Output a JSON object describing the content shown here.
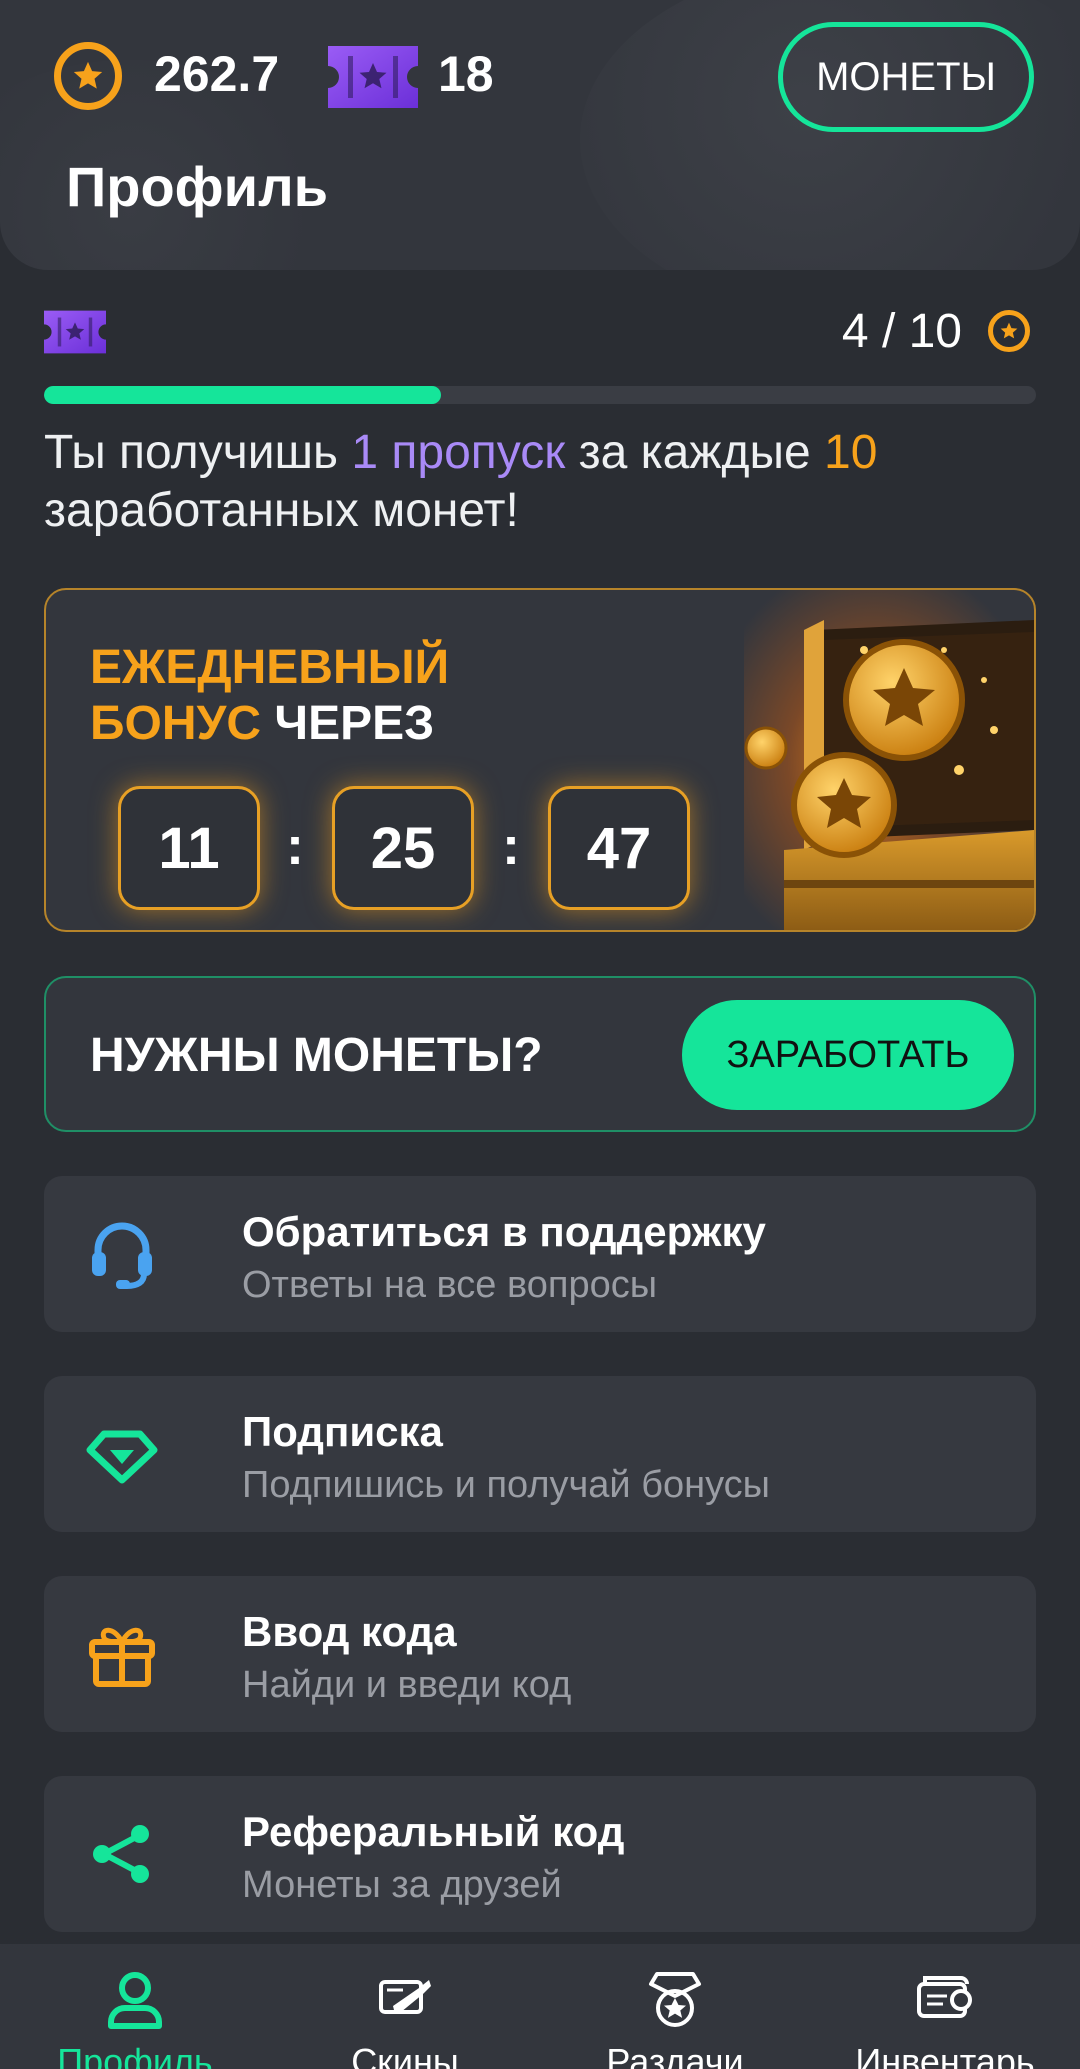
{
  "header": {
    "coins_balance": "262.7",
    "tickets_count": "18",
    "coins_button": "МОНЕТЫ",
    "page_title": "Профиль"
  },
  "progress": {
    "count": "4 / 10",
    "fraction": 0.4,
    "text_part1": "Ты получишь ",
    "text_highlight1": "1 пропуск",
    "text_part2": " за каждые ",
    "text_highlight2": "10",
    "text_part3": " заработанных монет!"
  },
  "daily_bonus": {
    "title_line1": "ЕЖЕДНЕВНЫЙ",
    "title_line2_highlight": "БОНУС",
    "title_line2_rest": " ЧЕРЕЗ",
    "hours": "11",
    "minutes": "25",
    "seconds": "47",
    "separator": ":"
  },
  "earn": {
    "title": "НУЖНЫ МОНЕТЫ?",
    "button": "ЗАРАБОТАТЬ"
  },
  "menu": [
    {
      "title": "Обратиться в поддержку",
      "subtitle": "Ответы на все вопросы",
      "icon": "headset-icon",
      "color": "#4aa3f0"
    },
    {
      "title": "Подписка",
      "subtitle": "Подпишись и получай бонусы",
      "icon": "diamond-icon",
      "color": "#15e59a"
    },
    {
      "title": "Ввод кода",
      "subtitle": "Найди и введи код",
      "icon": "gift-icon",
      "color": "#f7a21b"
    },
    {
      "title": "Реферальный код",
      "subtitle": "Монеты за друзей",
      "icon": "share-icon",
      "color": "#15e59a"
    }
  ],
  "nav": [
    {
      "label": "Профиль",
      "icon": "user-icon",
      "active": true
    },
    {
      "label": "Скины",
      "icon": "skins-icon",
      "active": false
    },
    {
      "label": "Раздачи",
      "icon": "giveaway-icon",
      "active": false
    },
    {
      "label": "Инвентарь",
      "icon": "inventory-icon",
      "active": false
    }
  ],
  "colors": {
    "accent_green": "#15e59a",
    "accent_orange": "#f7a21b",
    "accent_purple": "#a98af7",
    "background": "#2a2d33"
  }
}
